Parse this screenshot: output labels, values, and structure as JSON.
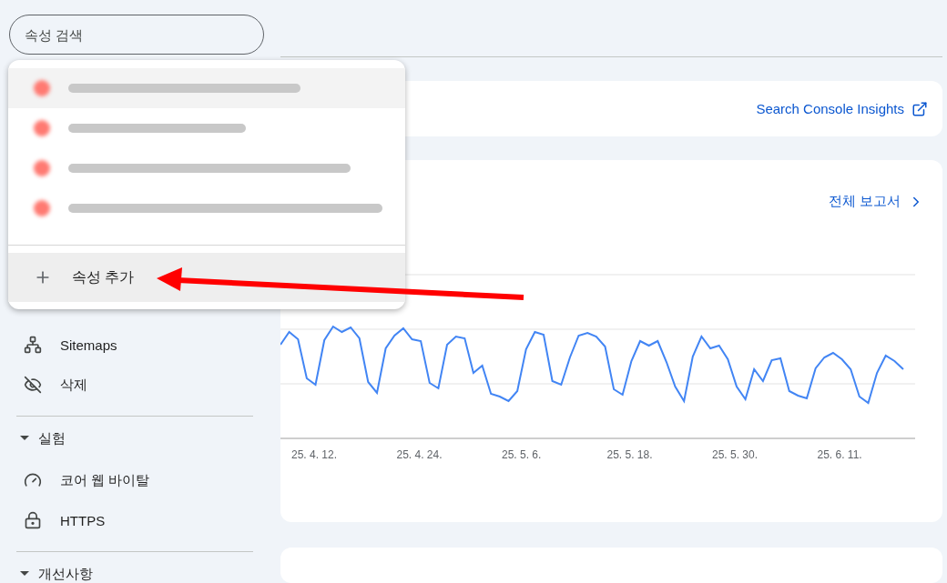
{
  "search": {
    "placeholder": "속성 검색"
  },
  "property_menu": {
    "items": [
      {
        "hovered": true
      },
      {
        "hovered": false
      },
      {
        "hovered": false
      },
      {
        "hovered": false
      }
    ],
    "add_label": "속성 추가"
  },
  "sidebar": [
    {
      "kind": "item",
      "label": "Sitemaps"
    },
    {
      "kind": "item",
      "label": "삭제"
    },
    {
      "kind": "section",
      "label": "실험",
      "expanded": true
    },
    {
      "kind": "item",
      "label": "코어 웹 바이탈"
    },
    {
      "kind": "item",
      "label": "HTTPS"
    },
    {
      "kind": "section",
      "label": "개선사항",
      "expanded": true
    }
  ],
  "insights_link": "Search Console Insights",
  "report_link": "전체 보고서",
  "chart": {
    "x_labels": [
      "25. 4. 12.",
      "25. 4. 24.",
      "25. 5. 6.",
      "25. 5. 18.",
      "25. 5. 30.",
      "25. 6. 11."
    ]
  }
}
